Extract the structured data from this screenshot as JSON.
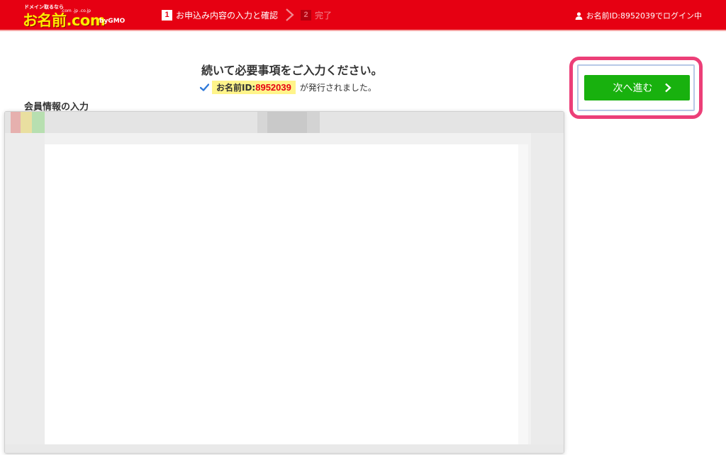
{
  "header": {
    "logo": {
      "tagline": "ドメイン取るなら",
      "name": "お名前.com",
      "domains": ".com .jp .co.jp",
      "company": "byGMO"
    },
    "steps": [
      {
        "number": "1",
        "label": "お申込み内容の入力と確認",
        "state": "active"
      },
      {
        "number": "2",
        "label": "完了",
        "state": "inactive"
      }
    ],
    "login_status": "お名前ID:8952039でログイン中",
    "colors": {
      "background": "#e60012",
      "logo_text": "#ffeb00"
    }
  },
  "main": {
    "headline": "続いて必要事項をご入力ください。",
    "issued": {
      "label": "お名前ID:",
      "id": "8952039",
      "suffix": "が発行されました。"
    },
    "next_button": {
      "label": "次へ進む",
      "color": "#18b10e",
      "highlight_color": "#ec3f78"
    },
    "section_heading": "会員情報の入力"
  },
  "icons": {
    "check": "check-icon",
    "user": "user-icon",
    "next": "chevron-right-icon",
    "step_separator": "chevron-right-icon"
  }
}
